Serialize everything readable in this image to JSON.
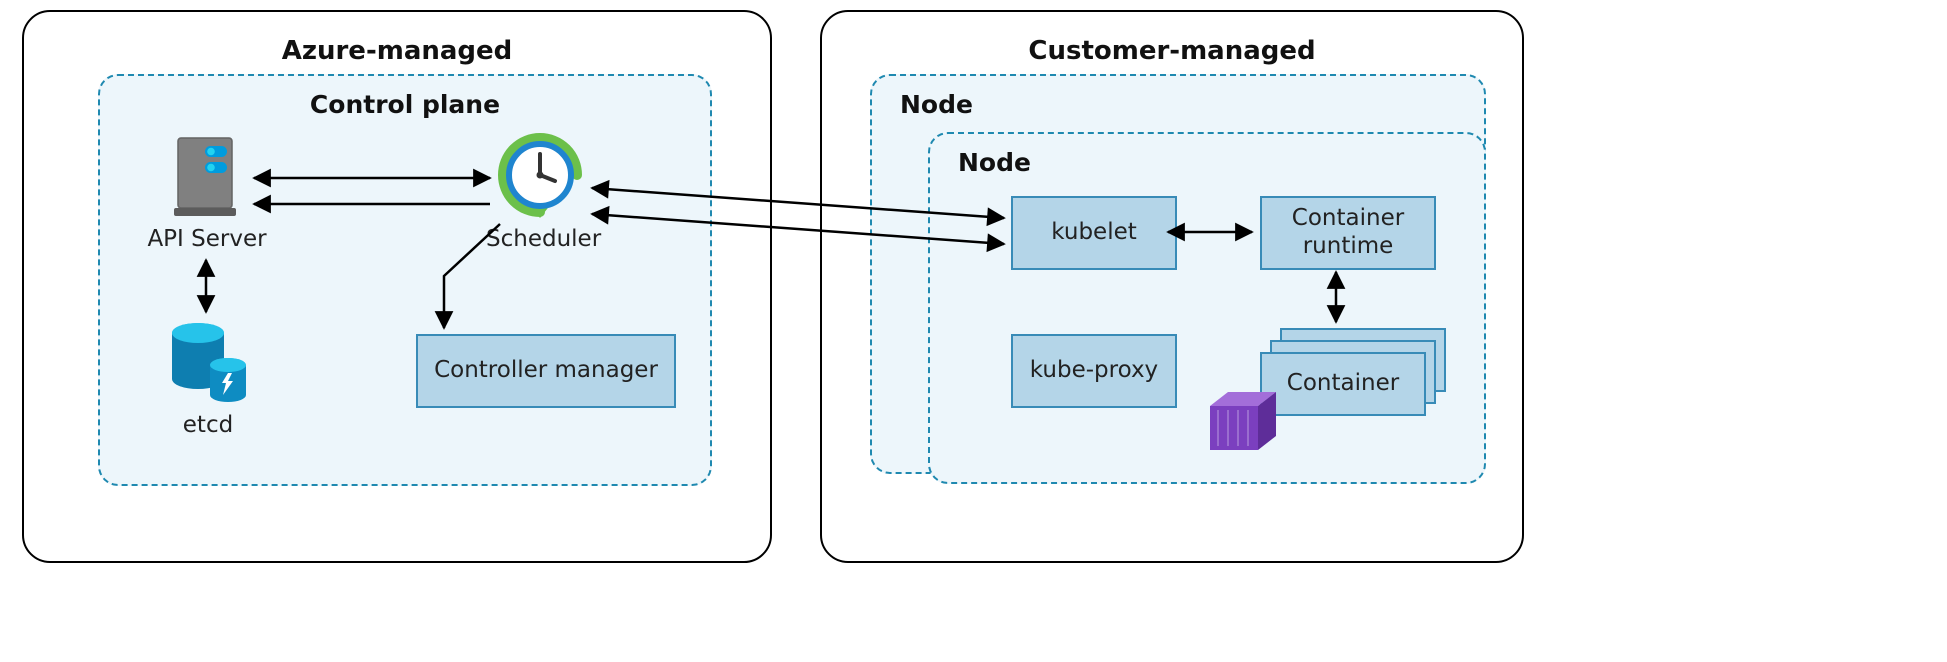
{
  "diagram": {
    "left": {
      "title": "Azure-managed",
      "inner_title": "Control plane",
      "api_server": "API Server",
      "scheduler": "Scheduler",
      "etcd": "etcd",
      "controller_manager": "Controller manager"
    },
    "right": {
      "title": "Customer-managed",
      "node_back": "Node",
      "node_front": "Node",
      "kubelet": "kubelet",
      "kube_proxy": "kube-proxy",
      "container_runtime": "Container\nruntime",
      "container": "Container"
    }
  }
}
